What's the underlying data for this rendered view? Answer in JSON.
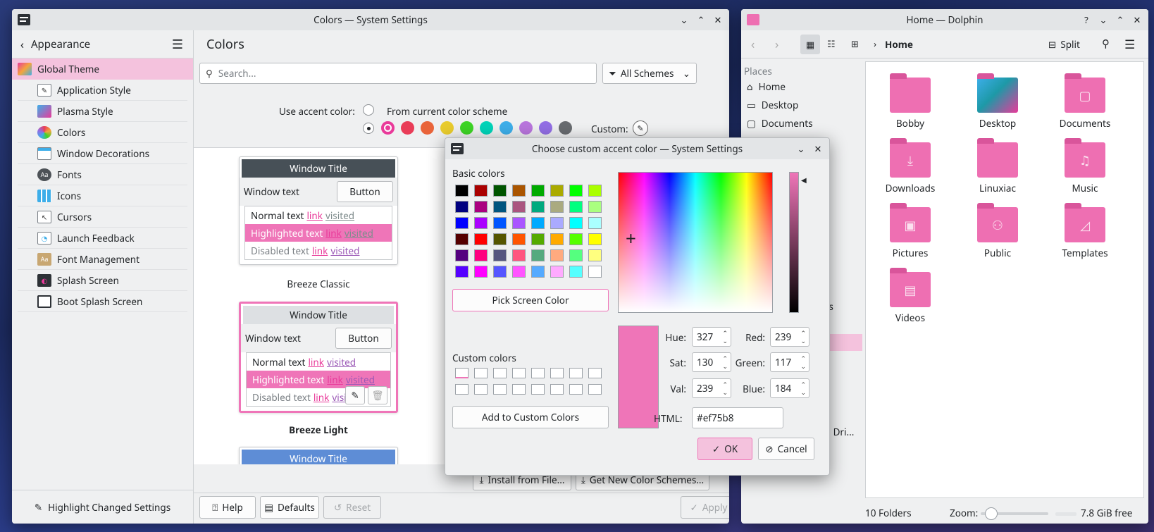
{
  "settings_window": {
    "title": "Colors — System Settings",
    "sidebar": {
      "header": "Appearance",
      "items": [
        {
          "label": "Global Theme",
          "selected": true
        },
        {
          "label": "Application Style"
        },
        {
          "label": "Plasma Style"
        },
        {
          "label": "Colors"
        },
        {
          "label": "Window Decorations"
        },
        {
          "label": "Fonts"
        },
        {
          "label": "Icons"
        },
        {
          "label": "Cursors"
        },
        {
          "label": "Launch Feedback"
        },
        {
          "label": "Font Management"
        },
        {
          "label": "Splash Screen"
        },
        {
          "label": "Boot Splash Screen"
        }
      ],
      "highlight_changed": "Highlight Changed Settings"
    },
    "page_title": "Colors",
    "search_placeholder": "Search...",
    "filter_label": "All Schemes",
    "accent_label": "Use accent color:",
    "accent_from_scheme": "From current color scheme",
    "accent_colors": [
      "#e93a9a",
      "#e93d58",
      "#e9643a",
      "#e8cb2d",
      "#3dd425",
      "#00d3b8",
      "#3daee9",
      "#b875dc",
      "#926ee4",
      "#686b6f"
    ],
    "custom_label": "Custom:",
    "schemes": [
      {
        "name": "Breeze Classic",
        "title": "Window Title",
        "window_text": "Window text",
        "button": "Button",
        "normal": "Normal text",
        "highlighted": "Highlighted text",
        "disabled": "Disabled text",
        "link": "link",
        "visited": "visited",
        "title_bg": "#475057"
      },
      {
        "name": "Breeze Light",
        "title": "Window Title",
        "window_text": "Window text",
        "button": "Button",
        "normal": "Normal text",
        "highlighted": "Highlighted text",
        "disabled": "Disabled text",
        "link": "link",
        "visited": "visited",
        "title_bg": "#dde0e3"
      },
      {
        "name": "",
        "title": "Window Title",
        "title_bg": "#5e8dd6"
      }
    ],
    "install_from_file": "Install from File...",
    "get_new": "Get New Color Schemes...",
    "footer": {
      "help": "Help",
      "defaults": "Defaults",
      "reset": "Reset",
      "apply": "Apply"
    }
  },
  "dialog": {
    "title": "Choose custom accent color — System Settings",
    "basic_colors_label": "Basic colors",
    "basic_colors": [
      "#000000",
      "#aa0000",
      "#005500",
      "#aa5500",
      "#00aa00",
      "#aaaa00",
      "#00ff00",
      "#aaff00",
      "#00007f",
      "#aa007f",
      "#00557f",
      "#aa557f",
      "#00aa7f",
      "#aaaa7f",
      "#00ff7f",
      "#aaff7f",
      "#0000ff",
      "#aa00ff",
      "#0055ff",
      "#aa55ff",
      "#00aaff",
      "#aaaaff",
      "#00ffff",
      "#aaffff",
      "#550000",
      "#ff0000",
      "#555500",
      "#ff5500",
      "#55aa00",
      "#ffaa00",
      "#55ff00",
      "#ffff00",
      "#55007f",
      "#ff007f",
      "#55557f",
      "#ff557f",
      "#55aa7f",
      "#ffaa7f",
      "#55ff7f",
      "#ffff7f",
      "#5500ff",
      "#ff00ff",
      "#5555ff",
      "#ff55ff",
      "#55aaff",
      "#ffaaff",
      "#55ffff",
      "#ffffff"
    ],
    "pick_screen_color": "Pick Screen Color",
    "custom_colors_label": "Custom colors",
    "add_to_custom": "Add to Custom Colors",
    "hue_label": "Hue:",
    "hue": "327",
    "sat_label": "Sat:",
    "sat": "130",
    "val_label": "Val:",
    "val": "239",
    "red_label": "Red:",
    "red": "239",
    "green_label": "Green:",
    "green": "117",
    "blue_label": "Blue:",
    "blue": "184",
    "html_label": "HTML:",
    "html": "#ef75b8",
    "current_color": "#ef75b8",
    "ok": "OK",
    "cancel": "Cancel"
  },
  "dolphin": {
    "title": "Home — Dolphin",
    "breadcrumb": "Home",
    "split": "Split",
    "places_label": "Places",
    "places": [
      "Home",
      "Desktop",
      "Documents"
    ],
    "partial_texts": [
      "ns",
      "al Dri..."
    ],
    "folders": [
      {
        "name": "Bobby",
        "glyph": ""
      },
      {
        "name": "Desktop",
        "glyph": ""
      },
      {
        "name": "Documents",
        "glyph": "▢"
      },
      {
        "name": "Downloads",
        "glyph": "⤓"
      },
      {
        "name": "Linuxiac",
        "glyph": ""
      },
      {
        "name": "Music",
        "glyph": "♫"
      },
      {
        "name": "Pictures",
        "glyph": "▣"
      },
      {
        "name": "Public",
        "glyph": "⚇"
      },
      {
        "name": "Templates",
        "glyph": "◿"
      },
      {
        "name": "Videos",
        "glyph": "▤"
      }
    ],
    "status_count": "10 Folders",
    "zoom_label": "Zoom:",
    "free_space": "7.8 GiB free"
  }
}
